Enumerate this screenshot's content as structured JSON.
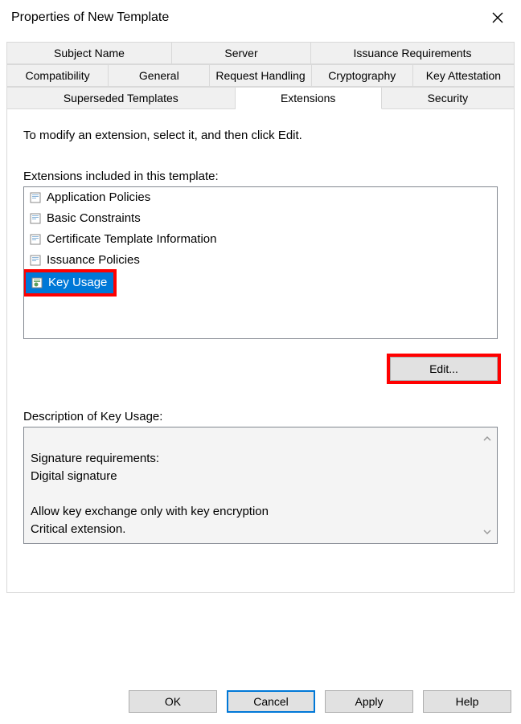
{
  "window": {
    "title": "Properties of New Template"
  },
  "tabs": {
    "row1": [
      "Subject Name",
      "Server",
      "Issuance Requirements"
    ],
    "row2": [
      "Compatibility",
      "General",
      "Request Handling",
      "Cryptography",
      "Key Attestation"
    ],
    "row3": [
      "Superseded Templates",
      "Extensions",
      "Security"
    ]
  },
  "body": {
    "instruction": "To modify an extension, select it, and then click Edit.",
    "list_label": "Extensions included in this template:",
    "extensions": [
      {
        "name": "Application Policies",
        "selected": false
      },
      {
        "name": "Basic Constraints",
        "selected": false
      },
      {
        "name": "Certificate Template Information",
        "selected": false
      },
      {
        "name": "Issuance Policies",
        "selected": false
      },
      {
        "name": "Key Usage",
        "selected": true
      }
    ],
    "edit_label": "Edit...",
    "desc_label": "Description of Key Usage:",
    "description": "Signature requirements:\nDigital signature\n\nAllow key exchange only with key encryption\nCritical extension."
  },
  "buttons": {
    "ok": "OK",
    "cancel": "Cancel",
    "apply": "Apply",
    "help": "Help"
  }
}
